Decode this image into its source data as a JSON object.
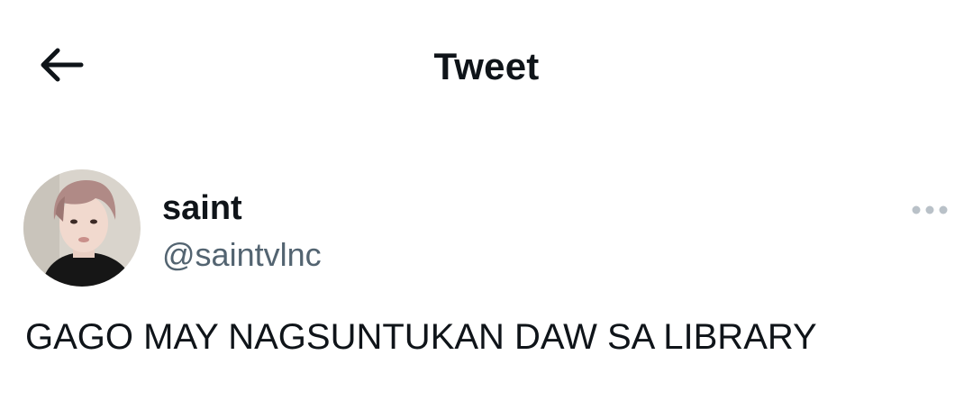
{
  "header": {
    "title": "Tweet",
    "back_icon": "arrow-left-icon"
  },
  "author": {
    "display_name": "saint",
    "handle": "@saintvlnc",
    "avatar_icon": "profile-photo"
  },
  "menu": {
    "more_icon": "ellipsis-icon"
  },
  "tweet": {
    "text": "GAGO MAY NAGSUNTUKAN DAW SA LIBRARY"
  },
  "colors": {
    "text_primary": "#0f1419",
    "text_secondary": "#536471",
    "icon_muted": "#b9c1c8",
    "background": "#ffffff"
  }
}
